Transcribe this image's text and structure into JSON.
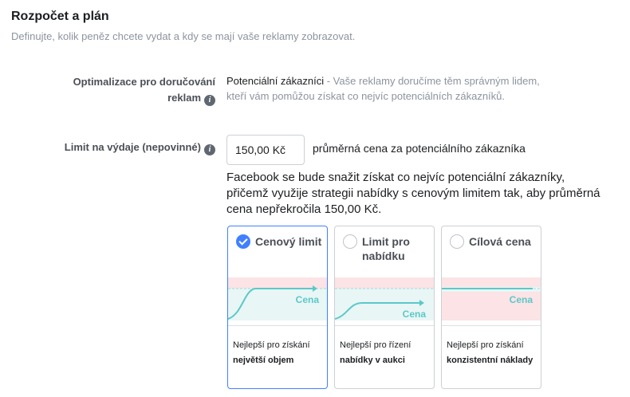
{
  "section": {
    "title": "Rozpočet a plán",
    "subtitle": "Definujte, kolik peněz chcete vydat a kdy se mají vaše reklamy zobrazovat."
  },
  "optimization": {
    "label_line1": "Optimalizace pro doručování",
    "label_line2": "reklam",
    "value": "Potenciální zákazníci",
    "description": " - Vaše reklamy doručíme těm správným lidem, kteří vám pomůžou získat co nejvíc potenciálních zákazníků."
  },
  "spend_limit": {
    "label": "Limit na výdaje (nepovinné)",
    "input_value": "150,00 Kč",
    "suffix": "průměrná cena za potenciálního zákazníka",
    "explanation": "Facebook se bude snažit získat co nejvíc potenciální zákazníky, přičemž využije strategii nabídky s cenovým limitem tak, aby průměrná cena nepřekročila 150,00 Kč."
  },
  "strategies": [
    {
      "title": "Cenový limit",
      "selected": true,
      "chart_label": "Cena",
      "desc_plain": "Nejlepší pro získání",
      "desc_bold": "největší objem"
    },
    {
      "title": "Limit pro nabídku",
      "selected": false,
      "chart_label": "Cena",
      "desc_plain": "Nejlepší pro řízení",
      "desc_bold": "nabídky v aukci"
    },
    {
      "title": "Cílová cena",
      "selected": false,
      "chart_label": "Cena",
      "desc_plain": "Nejlepší pro získání",
      "desc_bold": "konzistentní náklady"
    }
  ],
  "colors": {
    "accent": "#4080ff",
    "chart_line": "#5cc8c8",
    "danger_zone": "#f5c2c7",
    "safe_zone": "#e8f6f5"
  }
}
